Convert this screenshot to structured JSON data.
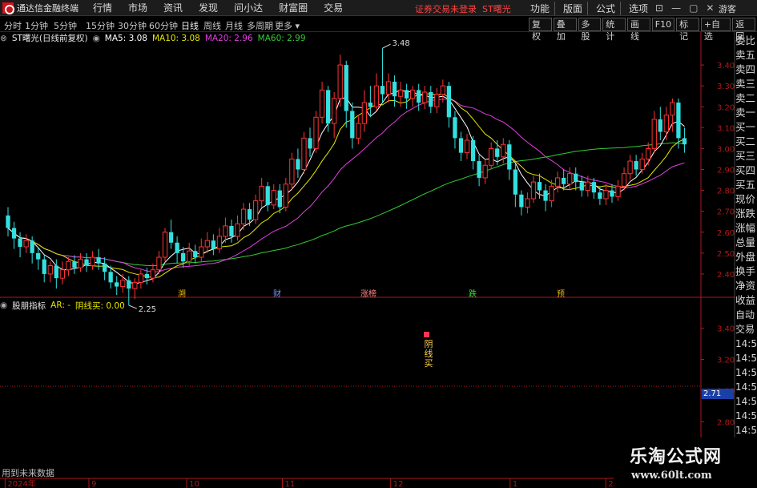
{
  "app": {
    "title": "通达信金融终端",
    "login_status": "证券交易未登录",
    "stock_name": "ST曙光",
    "guest": "游客"
  },
  "menu": [
    "行情",
    "市场",
    "资讯",
    "发现",
    "问小达",
    "财富圈",
    "交易"
  ],
  "right_menu": [
    "功能",
    "版面",
    "公式",
    "选项"
  ],
  "window_controls": [
    "⊡",
    "—",
    "▢",
    "✕"
  ],
  "periods": [
    "分时",
    "1分钟",
    "5分钟",
    "15分钟",
    "30分钟",
    "60分钟",
    "日线",
    "周线",
    "月线",
    "多周期",
    "更多"
  ],
  "active_period": "日线",
  "tools": [
    "复权",
    "叠加",
    "多股",
    "统计",
    "画线",
    "F10",
    "标记",
    "+自选",
    "返回"
  ],
  "legend": {
    "name": "ST曙光(日线前复权)",
    "ma5": "MA5: 3.08",
    "ma10": "MA10: 3.08",
    "ma20": "MA20: 2.96",
    "ma60": "MA60: 2.99"
  },
  "right_panel": [
    "委比",
    "卖五",
    "卖四",
    "卖三",
    "卖二",
    "卖一",
    "买一",
    "买二",
    "买三",
    "买四",
    "买五",
    "现价",
    "涨跌",
    "涨幅",
    "总量",
    "外盘",
    "换手",
    "净资",
    "收益"
  ],
  "indicator_legend": {
    "name": "股朋指标",
    "ar": "AR: -",
    "value": "阴线买: 0.00"
  },
  "indicator_signal": "阴线买",
  "ind_right_panel": [
    "自动",
    "交易",
    "14:53",
    "14:54",
    "14:54",
    "14:55",
    "14:55",
    "14:55",
    "14:56",
    "14:56"
  ],
  "future_label": "用到未来数据",
  "watermark": {
    "title": "乐淘公式网",
    "url": "www.60lt.com"
  },
  "current_price_label": "2.71",
  "colors": {
    "up": "#ff3333",
    "down": "#33e0e0",
    "ma5": "#ffffff",
    "ma10": "#e6e600",
    "ma20": "#e040e0",
    "ma60": "#33cc33",
    "axis": "#b01818"
  },
  "chart_data": {
    "type": "candlestick",
    "ylim": [
      2.3,
      3.5
    ],
    "yticks": [
      2.4,
      2.5,
      2.6,
      2.7,
      2.8,
      2.9,
      3.0,
      3.1,
      3.2,
      3.3,
      3.4
    ],
    "high_label": "3.48",
    "low_label": "2.25",
    "xticks": [
      "2024年",
      "9",
      "10",
      "11",
      "12",
      "1",
      "2"
    ],
    "event_markers": [
      "溯",
      "财",
      "涨榜",
      "跌",
      "预"
    ],
    "candles": [
      [
        2.68,
        2.62,
        2.72,
        2.58
      ],
      [
        2.62,
        2.57,
        2.65,
        2.52
      ],
      [
        2.57,
        2.53,
        2.6,
        2.48
      ],
      [
        2.53,
        2.56,
        2.59,
        2.5
      ],
      [
        2.56,
        2.5,
        2.58,
        2.45
      ],
      [
        2.5,
        2.47,
        2.53,
        2.42
      ],
      [
        2.47,
        2.4,
        2.49,
        2.36
      ],
      [
        2.4,
        2.44,
        2.46,
        2.36
      ],
      [
        2.44,
        2.38,
        2.47,
        2.33
      ],
      [
        2.38,
        2.42,
        2.46,
        2.35
      ],
      [
        2.42,
        2.46,
        2.48,
        2.39
      ],
      [
        2.46,
        2.43,
        2.49,
        2.4
      ],
      [
        2.43,
        2.47,
        2.5,
        2.41
      ],
      [
        2.47,
        2.44,
        2.5,
        2.41
      ],
      [
        2.44,
        2.48,
        2.51,
        2.42
      ],
      [
        2.48,
        2.45,
        2.52,
        2.42
      ],
      [
        2.45,
        2.41,
        2.48,
        2.37
      ],
      [
        2.41,
        2.36,
        2.44,
        2.33
      ],
      [
        2.36,
        2.34,
        2.39,
        2.3
      ],
      [
        2.34,
        2.37,
        2.4,
        2.31
      ],
      [
        2.37,
        2.33,
        2.39,
        2.25
      ],
      [
        2.33,
        2.36,
        2.38,
        2.28
      ],
      [
        2.36,
        2.4,
        2.42,
        2.33
      ],
      [
        2.4,
        2.38,
        2.43,
        2.35
      ],
      [
        2.38,
        2.42,
        2.45,
        2.36
      ],
      [
        2.42,
        2.48,
        2.51,
        2.4
      ],
      [
        2.48,
        2.6,
        2.62,
        2.46
      ],
      [
        2.6,
        2.55,
        2.66,
        2.52
      ],
      [
        2.55,
        2.5,
        2.58,
        2.45
      ],
      [
        2.5,
        2.46,
        2.53,
        2.43
      ],
      [
        2.46,
        2.51,
        2.55,
        2.44
      ],
      [
        2.51,
        2.48,
        2.54,
        2.45
      ],
      [
        2.48,
        2.53,
        2.57,
        2.46
      ],
      [
        2.53,
        2.56,
        2.6,
        2.5
      ],
      [
        2.56,
        2.52,
        2.59,
        2.49
      ],
      [
        2.52,
        2.58,
        2.62,
        2.5
      ],
      [
        2.58,
        2.63,
        2.67,
        2.55
      ],
      [
        2.63,
        2.58,
        2.66,
        2.55
      ],
      [
        2.58,
        2.64,
        2.68,
        2.56
      ],
      [
        2.64,
        2.71,
        2.74,
        2.61
      ],
      [
        2.71,
        2.66,
        2.74,
        2.63
      ],
      [
        2.66,
        2.75,
        2.78,
        2.64
      ],
      [
        2.75,
        2.82,
        2.86,
        2.72
      ],
      [
        2.82,
        2.73,
        2.84,
        2.7
      ],
      [
        2.73,
        2.8,
        2.83,
        2.71
      ],
      [
        2.8,
        2.72,
        2.83,
        2.69
      ],
      [
        2.72,
        2.83,
        2.86,
        2.7
      ],
      [
        2.83,
        2.95,
        2.98,
        2.8
      ],
      [
        2.95,
        2.9,
        3.0,
        2.86
      ],
      [
        2.9,
        3.05,
        3.08,
        2.88
      ],
      [
        3.05,
        3.0,
        3.1,
        2.96
      ],
      [
        3.0,
        3.15,
        3.18,
        2.98
      ],
      [
        3.15,
        3.28,
        3.32,
        3.12
      ],
      [
        3.28,
        3.12,
        3.3,
        3.08
      ],
      [
        3.12,
        3.24,
        3.27,
        3.05
      ],
      [
        3.24,
        3.4,
        3.45,
        3.2
      ],
      [
        3.4,
        3.18,
        3.42,
        3.1
      ],
      [
        3.18,
        3.05,
        3.22,
        3.0
      ],
      [
        3.05,
        3.12,
        3.16,
        3.02
      ],
      [
        3.12,
        3.22,
        3.28,
        3.08
      ],
      [
        3.22,
        3.2,
        3.3,
        3.15
      ],
      [
        3.2,
        3.3,
        3.36,
        3.18
      ],
      [
        3.3,
        3.26,
        3.48,
        3.22
      ],
      [
        3.26,
        3.32,
        3.36,
        3.22
      ],
      [
        3.32,
        3.25,
        3.35,
        3.2
      ],
      [
        3.25,
        3.28,
        3.32,
        3.2
      ],
      [
        3.28,
        3.24,
        3.31,
        3.19
      ],
      [
        3.24,
        3.28,
        3.3,
        3.2
      ],
      [
        3.28,
        3.22,
        3.31,
        3.18
      ],
      [
        3.22,
        3.27,
        3.3,
        3.19
      ],
      [
        3.27,
        3.2,
        3.3,
        3.17
      ],
      [
        3.2,
        3.26,
        3.29,
        3.17
      ],
      [
        3.26,
        3.3,
        3.33,
        3.22
      ],
      [
        3.3,
        3.15,
        3.32,
        3.1
      ],
      [
        3.15,
        3.05,
        3.18,
        3.0
      ],
      [
        3.05,
        2.98,
        3.08,
        2.94
      ],
      [
        2.98,
        3.04,
        3.07,
        2.95
      ],
      [
        3.04,
        2.94,
        3.06,
        2.9
      ],
      [
        2.94,
        2.86,
        2.97,
        2.82
      ],
      [
        2.86,
        2.92,
        2.95,
        2.83
      ],
      [
        2.92,
        3.0,
        3.03,
        2.9
      ],
      [
        3.0,
        2.96,
        3.04,
        2.92
      ],
      [
        2.96,
        3.02,
        3.05,
        2.93
      ],
      [
        3.02,
        2.9,
        3.04,
        2.85
      ],
      [
        2.9,
        2.78,
        2.93,
        2.72
      ],
      [
        2.78,
        2.72,
        2.8,
        2.68
      ],
      [
        2.72,
        2.76,
        2.79,
        2.69
      ],
      [
        2.76,
        2.84,
        2.87,
        2.74
      ],
      [
        2.84,
        2.8,
        2.88,
        2.76
      ],
      [
        2.8,
        2.75,
        2.83,
        2.7
      ],
      [
        2.75,
        2.82,
        2.85,
        2.72
      ],
      [
        2.82,
        2.86,
        2.89,
        2.79
      ],
      [
        2.86,
        2.83,
        2.9,
        2.8
      ],
      [
        2.83,
        2.88,
        2.91,
        2.8
      ],
      [
        2.88,
        2.84,
        2.91,
        2.8
      ],
      [
        2.84,
        2.8,
        2.87,
        2.77
      ],
      [
        2.8,
        2.84,
        2.87,
        2.77
      ],
      [
        2.84,
        2.79,
        2.86,
        2.76
      ],
      [
        2.79,
        2.76,
        2.82,
        2.73
      ],
      [
        2.76,
        2.8,
        2.83,
        2.73
      ],
      [
        2.8,
        2.77,
        2.83,
        2.74
      ],
      [
        2.77,
        2.82,
        2.85,
        2.75
      ],
      [
        2.82,
        2.88,
        2.91,
        2.8
      ],
      [
        2.88,
        2.94,
        2.97,
        2.85
      ],
      [
        2.94,
        2.9,
        2.97,
        2.87
      ],
      [
        2.9,
        2.95,
        2.98,
        2.88
      ],
      [
        2.95,
        3.0,
        3.03,
        2.92
      ],
      [
        3.0,
        3.14,
        3.18,
        2.98
      ],
      [
        3.14,
        3.08,
        3.2,
        3.04
      ],
      [
        3.08,
        3.16,
        3.2,
        3.04
      ],
      [
        3.16,
        3.22,
        3.24,
        3.08
      ],
      [
        3.22,
        3.05,
        3.24,
        3.0
      ],
      [
        3.05,
        3.02,
        3.1,
        2.98
      ]
    ],
    "indicator": {
      "ylim": [
        2.5,
        3.5
      ],
      "yticks": [
        2.6,
        2.8,
        3.0,
        3.2,
        3.4
      ],
      "signal_index": 88
    }
  }
}
